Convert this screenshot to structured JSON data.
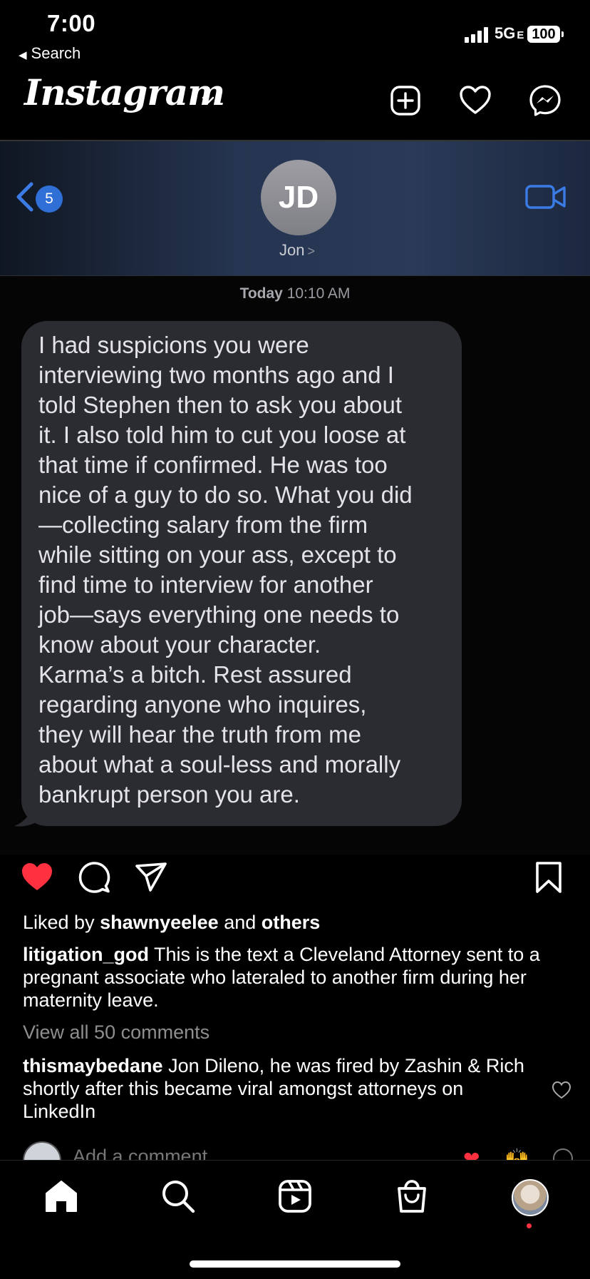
{
  "status_bar": {
    "time": "7:00",
    "back_label": "Search",
    "network": "5G",
    "network_suffix": "E",
    "battery": "100"
  },
  "header": {
    "logo": "Instagram",
    "icons": [
      "add-icon",
      "heart-icon",
      "messenger-icon"
    ]
  },
  "post_image": {
    "unread_count": "5",
    "avatar_initials": "JD",
    "contact_name": "Jon",
    "timestamp_day": "Today",
    "timestamp_time": "10:10 AM",
    "message": "I had suspicions you were\ninterviewing two months ago and I\ntold Stephen then to ask you about\nit. I also told him to cut you loose at\nthat time if confirmed. He was too\nnice of a guy to do so. What you did\n—collecting salary from the firm\nwhile sitting on your ass, except to\nfind time to interview for another\njob—says everything one needs to\nknow about your character.\nKarma’s a bitch. Rest assured\nregarding anyone who inquires,\nthey will hear the truth from me\nabout what a soul-less and morally\nbankrupt person you are.",
    "colors": {
      "bubble": "#2b2c31",
      "ios_blue": "#2f6fd6"
    }
  },
  "actions": {
    "liked": true,
    "like_color": "#ff3040"
  },
  "likes": {
    "prefix": "Liked by",
    "user": "shawnyeelee",
    "middle": "and",
    "suffix": "others"
  },
  "caption": {
    "username": "litigation_god",
    "text": "This is the text a Cleveland Attorney sent to a pregnant associate who lateraled to another firm during her maternity leave."
  },
  "comments": {
    "view_all": "View all 50 comments",
    "top": {
      "username": "thismaybedane",
      "text": "Jon Dileno, he was fired by Zashin & Rich shortly after this became viral amongst attorneys on LinkedIn"
    },
    "add_placeholder": "Add a comment…",
    "quick_reactions": [
      "❤",
      "🙌"
    ]
  },
  "tab_bar": {
    "tabs": [
      "home",
      "search",
      "reels",
      "shop",
      "profile"
    ]
  }
}
